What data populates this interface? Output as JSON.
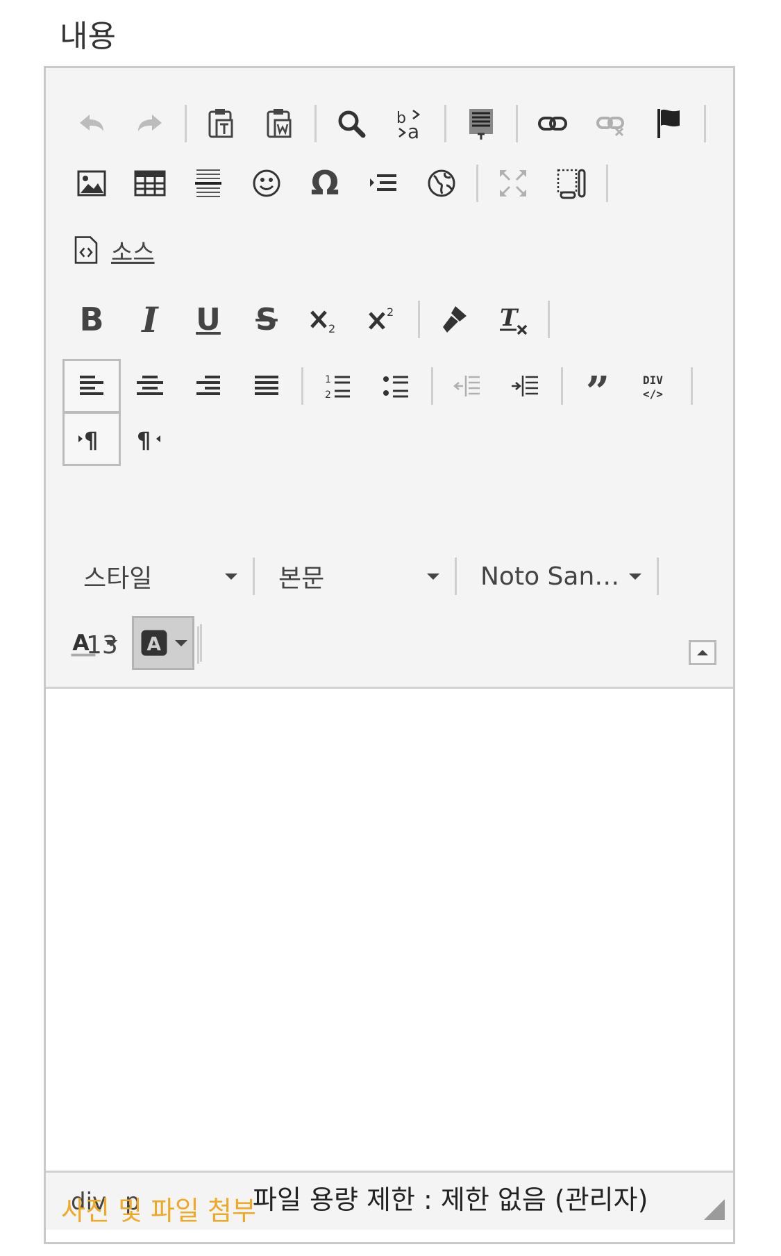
{
  "field_label": "내용",
  "toolbar": {
    "source_label": "소스",
    "style_combo": "스타일",
    "format_combo": "본문",
    "font_combo": "Noto San…",
    "size_combo": "13"
  },
  "elements_path": [
    "div",
    "p"
  ],
  "attach": {
    "link_label": "사진 및 파일 첨부",
    "info_text": "파일 용량 제한 : 제한 없음 (관리자)"
  },
  "icons": [
    "undo-icon",
    "redo-icon",
    "paste-text-icon",
    "paste-word-icon",
    "find-icon",
    "replace-icon",
    "templates-icon",
    "link-icon",
    "unlink-icon",
    "anchor-icon",
    "image-icon",
    "table-icon",
    "horizontal-rule-icon",
    "smiley-icon",
    "special-char-icon",
    "indent-block-icon",
    "iframe-icon",
    "maximize-icon",
    "show-blocks-icon",
    "source-icon",
    "bold-icon",
    "italic-icon",
    "underline-icon",
    "strike-icon",
    "subscript-icon",
    "superscript-icon",
    "copy-format-icon",
    "remove-format-icon",
    "align-left-icon",
    "align-center-icon",
    "align-right-icon",
    "align-justify-icon",
    "numbered-list-icon",
    "bulleted-list-icon",
    "outdent-icon",
    "indent-icon",
    "blockquote-icon",
    "create-div-icon",
    "ltr-icon",
    "rtl-icon",
    "text-color-icon",
    "bg-color-icon",
    "collapse-icon",
    "resize-grip-icon"
  ],
  "colors": {
    "accent": "#f0a926",
    "toolbar_bg": "#f4f4f4",
    "border": "#c9c9c9"
  }
}
